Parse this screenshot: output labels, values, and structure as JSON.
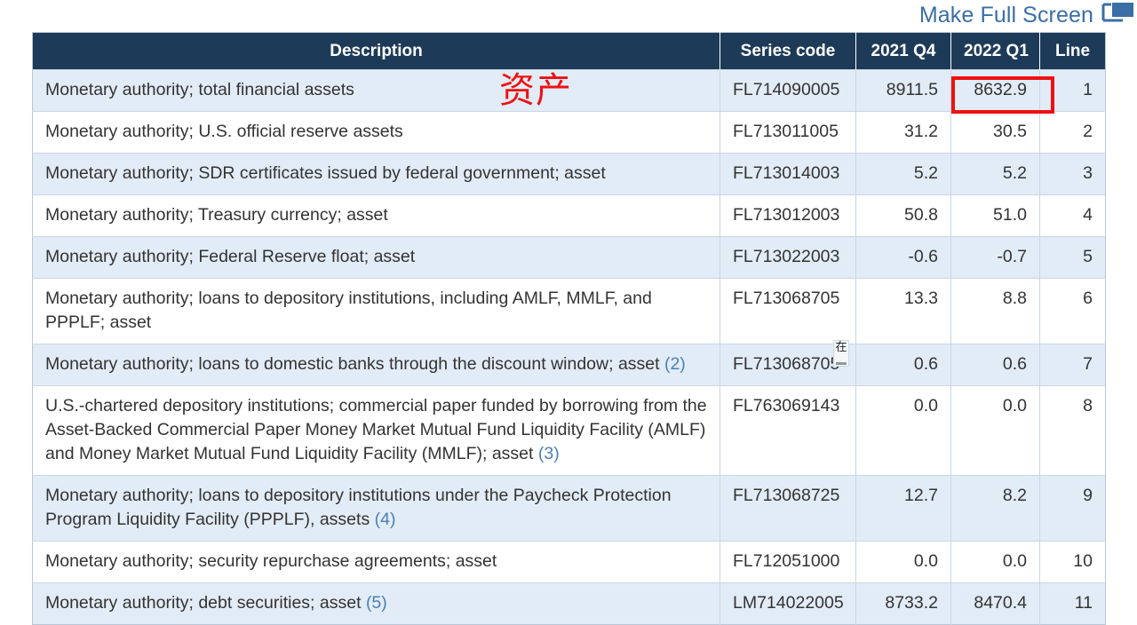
{
  "topbar": {
    "fullscreen_label": "Make Full Screen",
    "fullscreen_icon": "fullscreen-monitor-icon",
    "link_color": "#3a6ea5"
  },
  "annotations": {
    "chinese_note": "资产",
    "chinese_note_color": "#ee1111",
    "highlight_box_color": "#ee1111",
    "highlight_box_target": "8632.9",
    "ime_glyph": "在"
  },
  "table": {
    "header_bg": "#1d3b58",
    "alt_row_bg": "#e2ecf7",
    "columns": [
      {
        "key": "description",
        "label": "Description"
      },
      {
        "key": "series_code",
        "label": "Series code"
      },
      {
        "key": "q4_2021",
        "label": "2021 Q4"
      },
      {
        "key": "q1_2022",
        "label": "2022 Q1"
      },
      {
        "key": "line",
        "label": "Line"
      }
    ],
    "rows": [
      {
        "description": "Monetary authority; total financial assets",
        "footnote": "",
        "series_code": "FL714090005",
        "q4_2021": "8911.5",
        "q1_2022": "8632.9",
        "line": "1"
      },
      {
        "description": "Monetary authority; U.S. official reserve assets",
        "footnote": "",
        "series_code": "FL713011005",
        "q4_2021": "31.2",
        "q1_2022": "30.5",
        "line": "2"
      },
      {
        "description": "Monetary authority; SDR certificates issued by federal government; asset",
        "footnote": "",
        "series_code": "FL713014003",
        "q4_2021": "5.2",
        "q1_2022": "5.2",
        "line": "3"
      },
      {
        "description": "Monetary authority; Treasury currency; asset",
        "footnote": "",
        "series_code": "FL713012003",
        "q4_2021": "50.8",
        "q1_2022": "51.0",
        "line": "4"
      },
      {
        "description": "Monetary authority; Federal Reserve float; asset",
        "footnote": "",
        "series_code": "FL713022003",
        "q4_2021": "-0.6",
        "q1_2022": "-0.7",
        "line": "5"
      },
      {
        "description": "Monetary authority; loans to depository institutions, including AMLF, MMLF, and PPPLF; asset",
        "footnote": "",
        "series_code": "FL713068705",
        "q4_2021": "13.3",
        "q1_2022": "8.8",
        "line": "6"
      },
      {
        "description": "Monetary authority; loans to domestic banks through the discount window; asset",
        "footnote": "(2)",
        "series_code": "FL713068705",
        "q4_2021": "0.6",
        "q1_2022": "0.6",
        "line": "7"
      },
      {
        "description": "U.S.-chartered depository institutions; commercial paper funded by borrowing from the Asset-Backed Commercial Paper Money Market Mutual Fund Liquidity Facility (AMLF) and Money Market Mutual Fund Liquidity Facility (MMLF); asset",
        "footnote": "(3)",
        "series_code": "FL763069143",
        "q4_2021": "0.0",
        "q1_2022": "0.0",
        "line": "8"
      },
      {
        "description": "Monetary authority; loans to depository institutions under the Paycheck Protection Program Liquidity Facility (PPPLF), assets",
        "footnote": "(4)",
        "series_code": "FL713068725",
        "q4_2021": "12.7",
        "q1_2022": "8.2",
        "line": "9"
      },
      {
        "description": "Monetary authority; security repurchase agreements; asset",
        "footnote": "",
        "series_code": "FL712051000",
        "q4_2021": "0.0",
        "q1_2022": "0.0",
        "line": "10"
      },
      {
        "description": "Monetary authority; debt securities; asset",
        "footnote": "(5)",
        "series_code": "LM714022005",
        "q4_2021": "8733.2",
        "q1_2022": "8470.4",
        "line": "11"
      }
    ]
  }
}
